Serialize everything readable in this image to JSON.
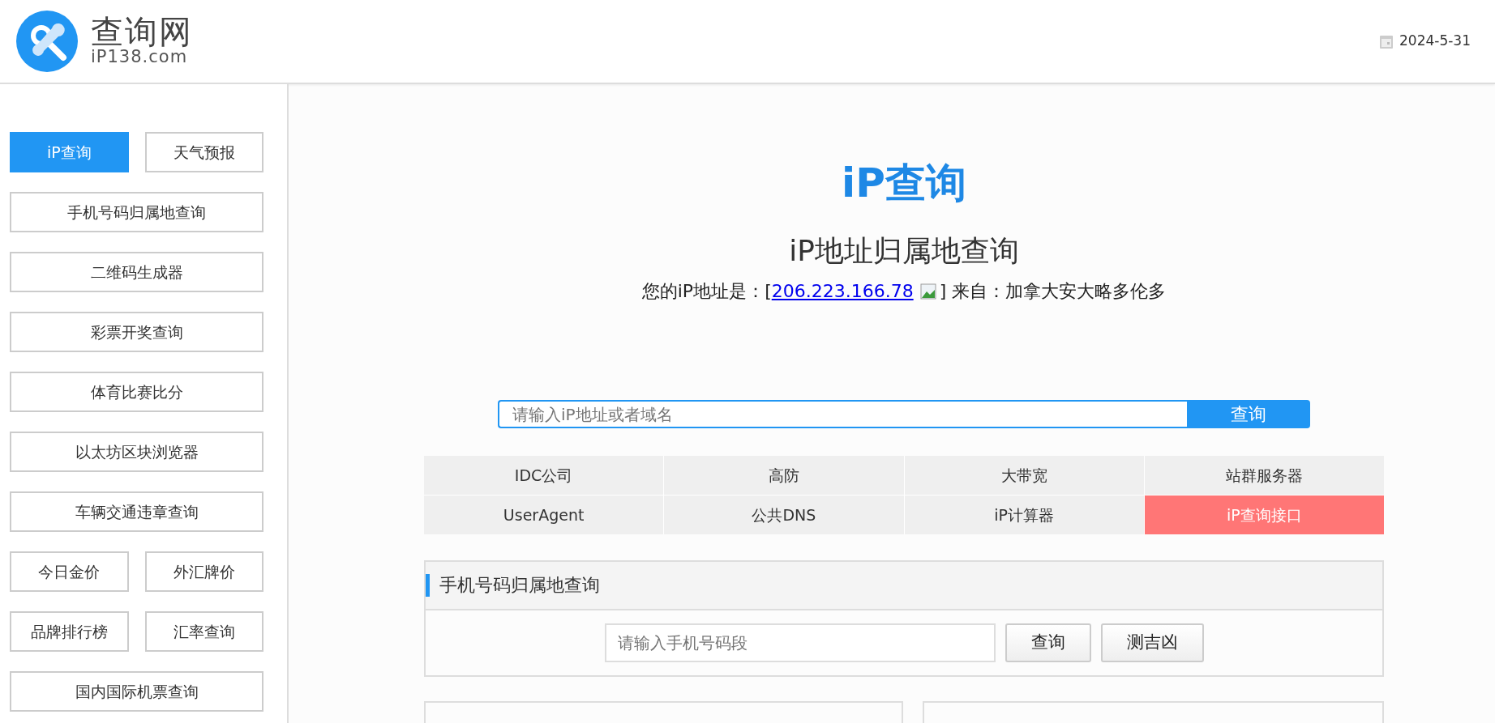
{
  "header": {
    "logo_title": "查询网",
    "logo_subtitle": "iP138.com",
    "date": "2024-5-31"
  },
  "sidebar": {
    "rows": [
      [
        {
          "label": "iP查询",
          "selected": true
        },
        {
          "label": "天气预报",
          "selected": false
        }
      ],
      [
        {
          "label": "手机号码归属地查询",
          "selected": false
        }
      ],
      [
        {
          "label": "二维码生成器",
          "selected": false
        }
      ],
      [
        {
          "label": "彩票开奖查询",
          "selected": false
        }
      ],
      [
        {
          "label": "体育比赛比分",
          "selected": false
        }
      ],
      [
        {
          "label": "以太坊区块浏览器",
          "selected": false
        }
      ],
      [
        {
          "label": "车辆交通违章查询",
          "selected": false
        }
      ],
      [
        {
          "label": "今日金价",
          "selected": false
        },
        {
          "label": "外汇牌价",
          "selected": false
        }
      ],
      [
        {
          "label": "品牌排行榜",
          "selected": false
        },
        {
          "label": "汇率查询",
          "selected": false
        }
      ],
      [
        {
          "label": "国内国际机票查询",
          "selected": false
        }
      ]
    ]
  },
  "main": {
    "title": "iP查询",
    "subtitle": "iP地址归属地查询",
    "ip_line": {
      "prefix": "您的iP地址是：[",
      "ip": "206.223.166.78",
      "suffix": "] 来自：加拿大安大略多伦多"
    },
    "search": {
      "placeholder": "请输入iP地址或者域名",
      "button": "查询"
    },
    "links": [
      {
        "label": "IDC公司",
        "highlight": false
      },
      {
        "label": "高防",
        "highlight": false
      },
      {
        "label": "大带宽",
        "highlight": false
      },
      {
        "label": "站群服务器",
        "highlight": false
      },
      {
        "label": "UserAgent",
        "highlight": false
      },
      {
        "label": "公共DNS",
        "highlight": false
      },
      {
        "label": "iP计算器",
        "highlight": false
      },
      {
        "label": "iP查询接口",
        "highlight": true
      }
    ],
    "phone_panel": {
      "title": "手机号码归属地查询",
      "placeholder": "请输入手机号码段",
      "buttons": [
        "查询",
        "测吉凶"
      ]
    }
  }
}
